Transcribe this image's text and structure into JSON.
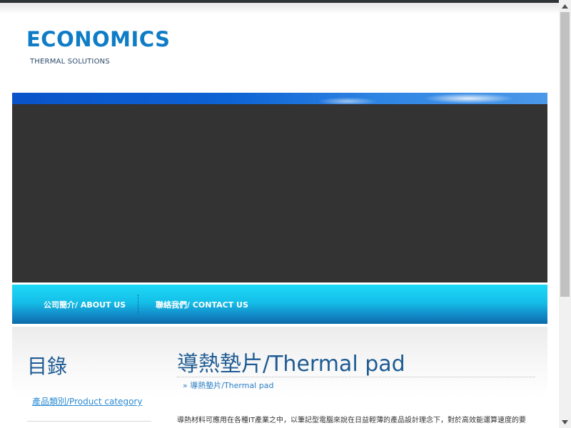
{
  "site": {
    "logo": "ECONOMICS",
    "slogan": "THERMAL SOLUTIONS"
  },
  "nav": {
    "items": [
      {
        "label": "公司簡介/ ABOUT US"
      },
      {
        "label": "聯絡我們/ CONTACT US"
      }
    ]
  },
  "sidebar": {
    "title": "目錄",
    "links": [
      {
        "label": "產品類別/Product category"
      }
    ]
  },
  "main": {
    "title": "導熱墊片/Thermal pad",
    "breadcrumb_sep": "»",
    "breadcrumb": "導熱墊片/Thermal pad",
    "body": "導熱材料可應用在各種IT產業之中，以筆記型電腦來說在日益輕薄的產品設計理念下，對於高效能運算速度的要"
  },
  "colors": {
    "logo": "#0f7cc6",
    "heading": "#1e5b93",
    "link": "#2a8bd4",
    "nav_top": "#1fd9f7",
    "nav_bottom": "#0d6aa8",
    "banner_dark": "#333333"
  },
  "scrollbar": {
    "up_icon": "triangle-up",
    "down_icon": "triangle-down"
  }
}
